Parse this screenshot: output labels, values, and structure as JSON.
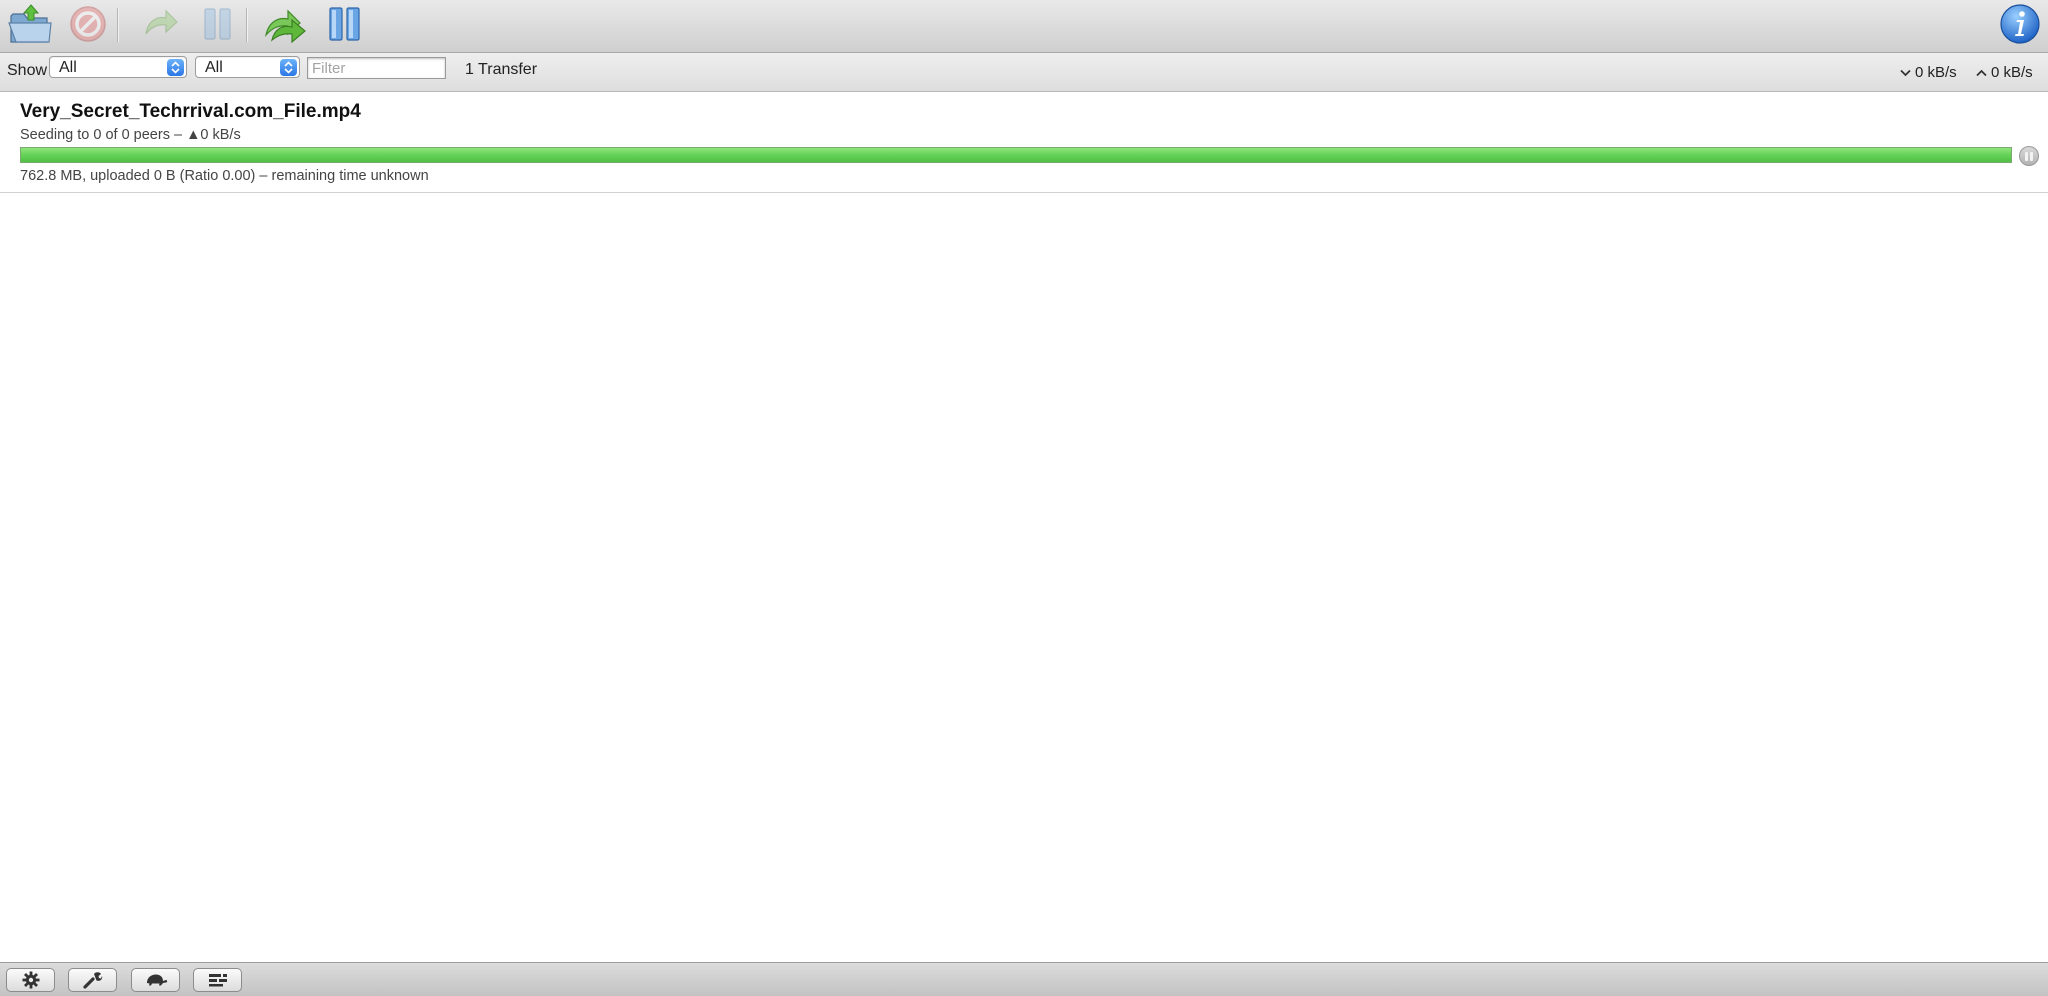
{
  "window": {
    "app": "Transmission"
  },
  "toolbar": {
    "buttons": [
      {
        "id": "open",
        "icon": "open-folder-icon",
        "enabled": true
      },
      {
        "id": "remove",
        "icon": "remove-icon",
        "enabled": false
      },
      {
        "id": "resume",
        "icon": "resume-icon",
        "enabled": false
      },
      {
        "id": "pause",
        "icon": "pause-icon",
        "enabled": false
      },
      {
        "id": "resume-all",
        "icon": "resume-all-icon",
        "enabled": true
      },
      {
        "id": "pause-all",
        "icon": "pause-all-icon",
        "enabled": true
      },
      {
        "id": "inspector",
        "icon": "info-icon",
        "enabled": true
      }
    ]
  },
  "filterbar": {
    "show_label": "Show",
    "status_filter": "All",
    "group_filter": "All",
    "search_placeholder": "Filter",
    "transfer_count": "1 Transfer",
    "download_speed": "0 kB/s",
    "upload_speed": "0 kB/s"
  },
  "transfers": [
    {
      "name": "Very_Secret_Techrrival.com_File.mp4",
      "status": "Seeding to 0 of 0 peers – ▲0 kB/s",
      "details": "762.8 MB, uploaded 0 B (Ratio 0.00) – remaining time unknown",
      "progress_percent": 100,
      "state": "seeding"
    }
  ],
  "bottombar": {
    "buttons": [
      {
        "id": "action",
        "icon": "gear-icon"
      },
      {
        "id": "preferences",
        "icon": "wrench-icon"
      },
      {
        "id": "speed-limit",
        "icon": "turtle-icon"
      },
      {
        "id": "filter-bar",
        "icon": "filter-bar-icon"
      }
    ]
  },
  "colors": {
    "progress_seeding": "#62cf55",
    "accent_blue": "#2a77e6"
  }
}
